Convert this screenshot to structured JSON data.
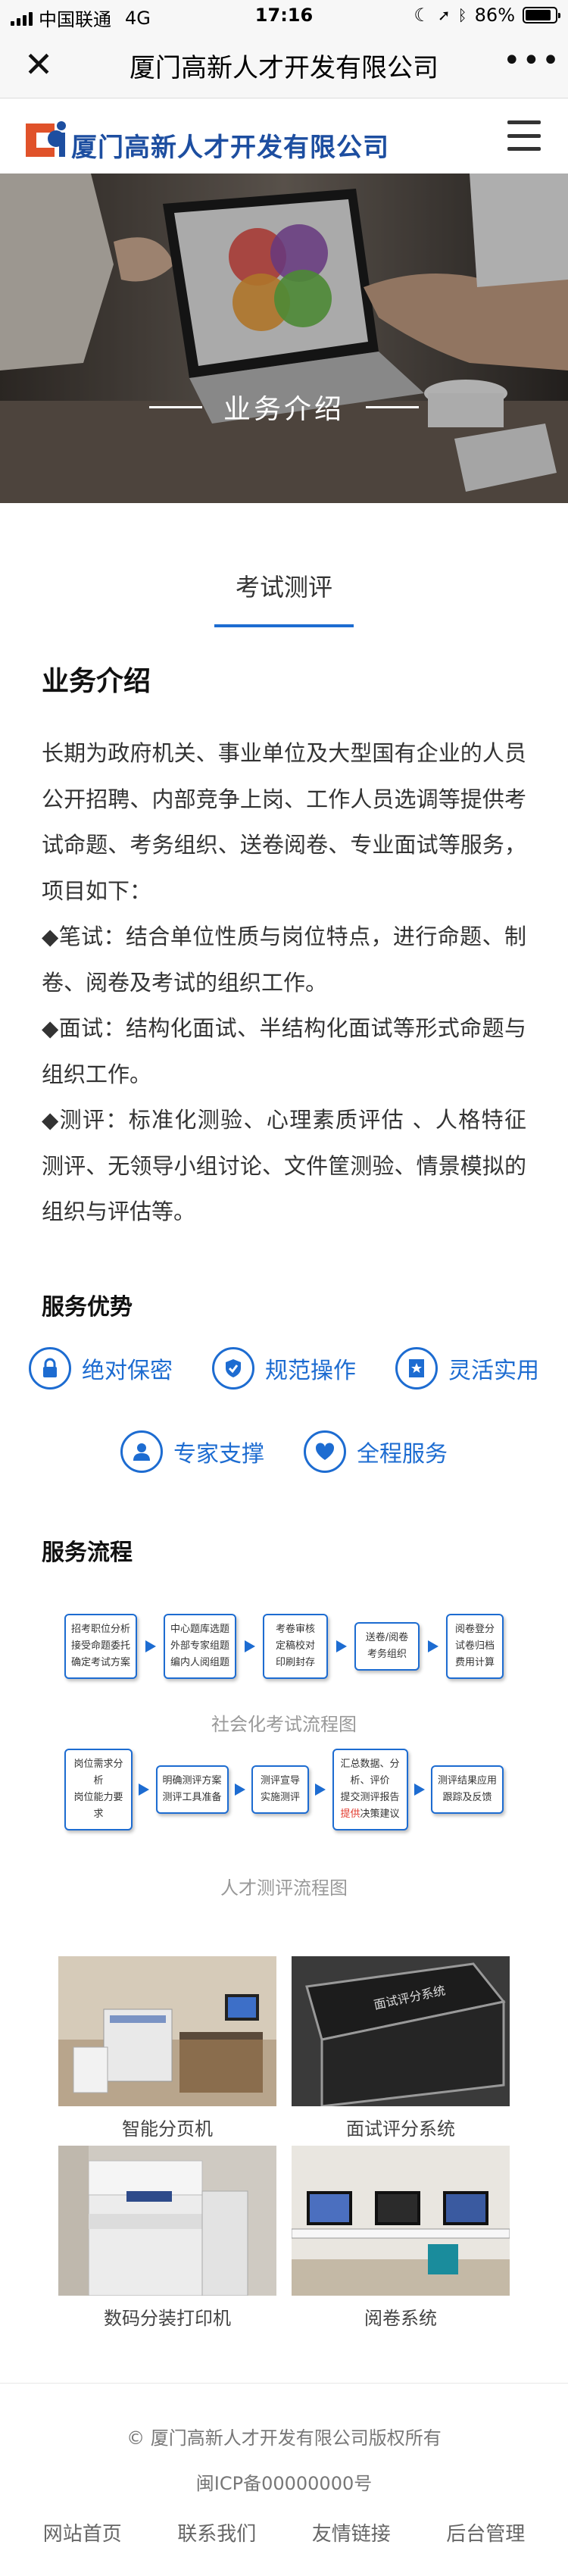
{
  "status_bar": {
    "carrier": "中国联通",
    "network": "4G",
    "time": "17:16",
    "battery": "86%",
    "battery_level": 0.86
  },
  "title_bar": {
    "close_icon": "close-icon",
    "title": "厦门高新人才开发有限公司",
    "more_icon": "more-icon"
  },
  "header": {
    "logo_text": "厦门高新人才开发有限公司",
    "menu_icon": "hamburger-icon",
    "brand_colors": {
      "blue": "#1d4ea0",
      "orange": "#e0522a"
    }
  },
  "banner": {
    "title": "业务介绍"
  },
  "tab": {
    "label": "考试测评",
    "accent": "#1d6cd1"
  },
  "intro": {
    "heading": "业务介绍",
    "paragraphs": [
      "长期为政府机关、事业单位及大型国有企业的人员公开招聘、内部竞争上岗、工作人员选调等提供考试命题、考务组织、送卷阅卷、专业面试等服务，项目如下：",
      "◆笔试：结合单位性质与岗位特点，进行命题、制卷、阅卷及考试的组织工作。",
      "◆面试：结构化面试、半结构化面试等形式命题与组织工作。",
      "◆测评：标准化测验、心理素质评估 、人格特征测评、无领导小组讨论、文件筐测验、情景模拟的组织与评估等。"
    ]
  },
  "advantages": {
    "heading": "服务优势",
    "items": [
      {
        "label": "绝对保密",
        "icon": "lock-icon"
      },
      {
        "label": "规范操作",
        "icon": "shield-check-icon"
      },
      {
        "label": "灵活实用",
        "icon": "badge-star-icon"
      },
      {
        "label": "专家支撑",
        "icon": "user-icon"
      },
      {
        "label": "全程服务",
        "icon": "heart-icon"
      }
    ]
  },
  "process": {
    "heading": "服务流程",
    "flow1": {
      "caption": "社会化考试流程图",
      "boxes": [
        [
          "招考职位分析",
          "接受命题委托",
          "确定考试方案"
        ],
        [
          "中心题库选题",
          "外部专家组题",
          "编内人阅组题"
        ],
        [
          "考卷审核",
          "定稿校对",
          "印刷封存"
        ],
        [
          "送卷/阅卷",
          "考务组织"
        ],
        [
          "阅卷登分",
          "试卷归档",
          "费用计算"
        ]
      ]
    },
    "flow2": {
      "caption": "人才测评流程图",
      "boxes": [
        [
          "岗位需求分析",
          "岗位能力要求"
        ],
        [
          "明确测评方案",
          "测评工具准备"
        ],
        [
          "测评宣导",
          "实施测评"
        ],
        [
          "汇总数据、分",
          "析、评价",
          "提交测评报告",
          "提供决策建议"
        ],
        [
          "测评结果应用",
          "跟踪及反馈"
        ]
      ],
      "highlight": "提供"
    }
  },
  "gallery": {
    "items": [
      {
        "caption": "智能分页机"
      },
      {
        "caption": "面试评分系统"
      },
      {
        "caption": "数码分装打印机"
      },
      {
        "caption": "阅卷系统"
      }
    ],
    "case_label": "面试评分系统"
  },
  "footer": {
    "copyright": "© 厦门高新人才开发有限公司版权所有",
    "icp": "闽ICP备00000000号",
    "nav": [
      "网站首页",
      "联系我们",
      "友情链接",
      "后台管理"
    ]
  }
}
